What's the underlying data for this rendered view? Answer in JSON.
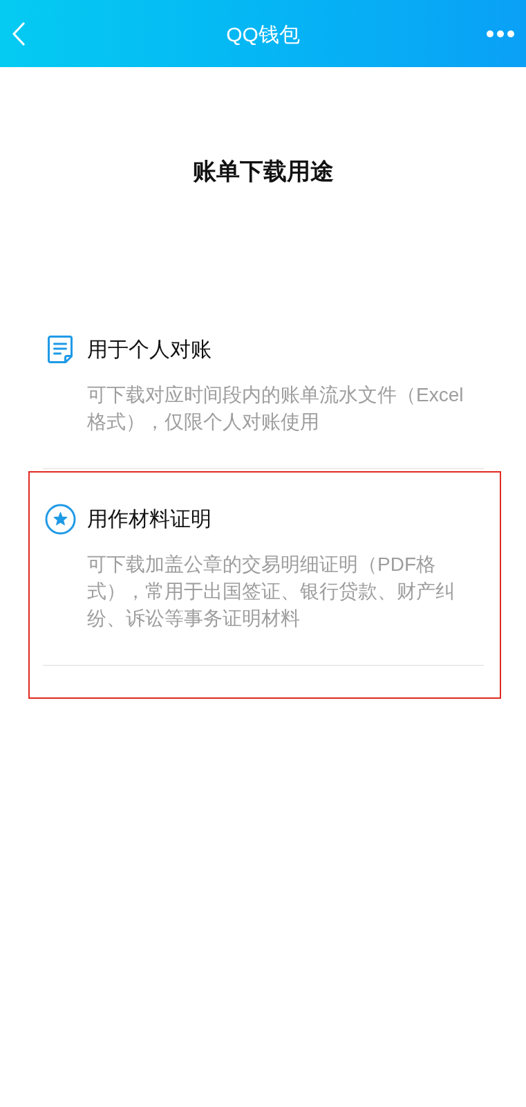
{
  "header": {
    "title": "QQ钱包"
  },
  "page_title": "账单下载用途",
  "options": [
    {
      "kind": "document",
      "title": "用于个人对账",
      "description": "可下载对应时间段内的账单流水文件（Excel格式），仅限个人对账使用",
      "highlighted": false
    },
    {
      "kind": "star",
      "title": "用作材料证明",
      "description": "可下载加盖公章的交易明细证明（PDF格式），常用于出国签证、银行贷款、财产纠纷、诉讼等事务证明材料",
      "highlighted": true
    }
  ]
}
